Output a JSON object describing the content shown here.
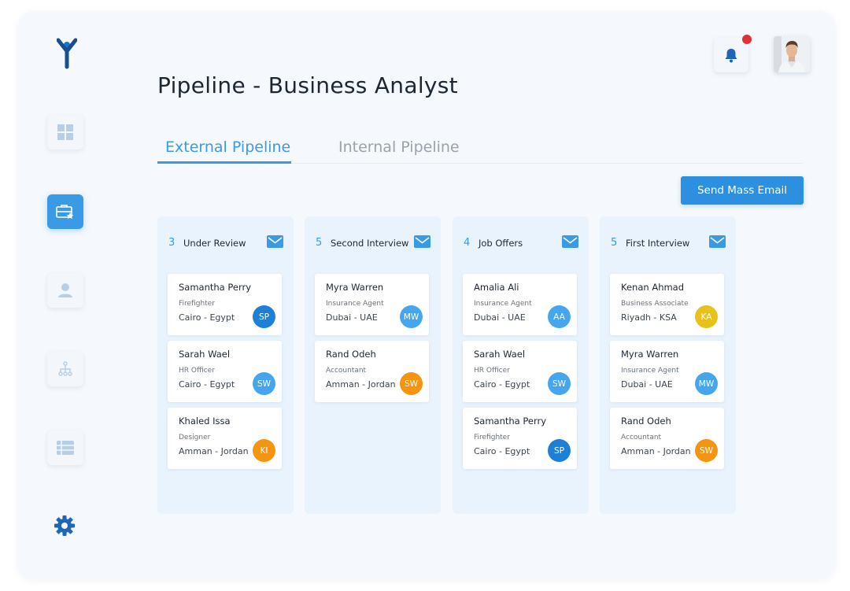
{
  "page_title": "Pipeline - Business Analyst",
  "tabs": {
    "external": "External Pipeline",
    "internal": "Internal Pipeline"
  },
  "mass_email_label": "Send Mass Email",
  "colors": {
    "accent": "#3a9ae6",
    "button": "#2d8fe0",
    "notification": "#e03233",
    "column_bg": "#e8f3fd"
  },
  "icons": {
    "logo": "y-logo",
    "sidebar": [
      "dashboard-icon",
      "briefcase-star-icon",
      "user-icon",
      "org-chart-icon",
      "list-icon"
    ],
    "settings": "gear-icon",
    "bell": "bell-icon",
    "mail": "mail-icon"
  },
  "columns": [
    {
      "count": "3",
      "title": "Under Review",
      "cards": [
        {
          "name": "Samantha Perry",
          "role": "Firefighter",
          "location": "Cairo - Egypt",
          "initials": "SP",
          "color": "#1e7fd6"
        },
        {
          "name": "Sarah Wael",
          "role": "HR Officer",
          "location": "Cairo - Egypt",
          "initials": "SW",
          "color": "#45a6ee"
        },
        {
          "name": "Khaled Issa",
          "role": "Designer",
          "location": "Amman - Jordan",
          "initials": "KI",
          "color": "#f5940f"
        }
      ]
    },
    {
      "count": "5",
      "title": "Second Interview",
      "cards": [
        {
          "name": "Myra Warren",
          "role": "Insurance Agent",
          "location": "Dubai - UAE",
          "initials": "MW",
          "color": "#45a6ee"
        },
        {
          "name": "Rand Odeh",
          "role": "Accountant",
          "location": "Amman - Jordan",
          "initials": "SW",
          "color": "#f5940f"
        }
      ]
    },
    {
      "count": "4",
      "title": "Job Offers",
      "cards": [
        {
          "name": "Amalia Ali",
          "role": "Insurance Agent",
          "location": "Dubai - UAE",
          "initials": "AA",
          "color": "#45a6ee"
        },
        {
          "name": "Sarah Wael",
          "role": "HR Officer",
          "location": "Cairo - Egypt",
          "initials": "SW",
          "color": "#45a6ee"
        },
        {
          "name": "Samantha Perry",
          "role": "Firefighter",
          "location": "Cairo - Egypt",
          "initials": "SP",
          "color": "#1e7fd6"
        }
      ]
    },
    {
      "count": "5",
      "title": "First Interview",
      "cards": [
        {
          "name": "Kenan Ahmad",
          "role": "Business Associate",
          "location": "Riyadh - KSA",
          "initials": "KA",
          "color": "#e8c21a"
        },
        {
          "name": "Myra Warren",
          "role": "Insurance Agent",
          "location": "Dubai - UAE",
          "initials": "MW",
          "color": "#45a6ee"
        },
        {
          "name": "Rand Odeh",
          "role": "Accountant",
          "location": "Amman - Jordan",
          "initials": "SW",
          "color": "#f5940f"
        }
      ]
    }
  ]
}
